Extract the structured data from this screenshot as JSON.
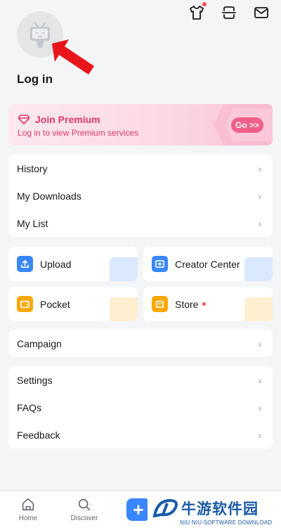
{
  "header": {
    "icons": [
      "tshirt-icon",
      "scan-icon",
      "mail-icon"
    ],
    "has_notification_on_tshirt": true
  },
  "profile": {
    "login_label": "Log in"
  },
  "premium": {
    "title": "Join Premium",
    "subtitle": "Log in to view Premium services",
    "button_label": "Go >>"
  },
  "menu_group_1": [
    {
      "label": "History"
    },
    {
      "label": "My Downloads"
    },
    {
      "label": "My List"
    }
  ],
  "tiles": {
    "upload": "Upload",
    "creator_center": "Creator Center",
    "pocket": "Pocket",
    "store": "Store"
  },
  "menu_group_2": [
    {
      "label": "Campaign"
    }
  ],
  "menu_group_3": [
    {
      "label": "Settings"
    },
    {
      "label": "FAQs"
    },
    {
      "label": "Feedback"
    }
  ],
  "bottom_nav": {
    "home": "Home",
    "discover": "Discover"
  },
  "watermark": {
    "brand_cn": "牛游软件园",
    "brand_en": "NIU NIU SOFTWARE DOWNLOAD"
  },
  "colors": {
    "accent_pink": "#e0386c",
    "blue": "#3a86ff",
    "orange": "#ffa800",
    "background": "#f4f5f7"
  }
}
